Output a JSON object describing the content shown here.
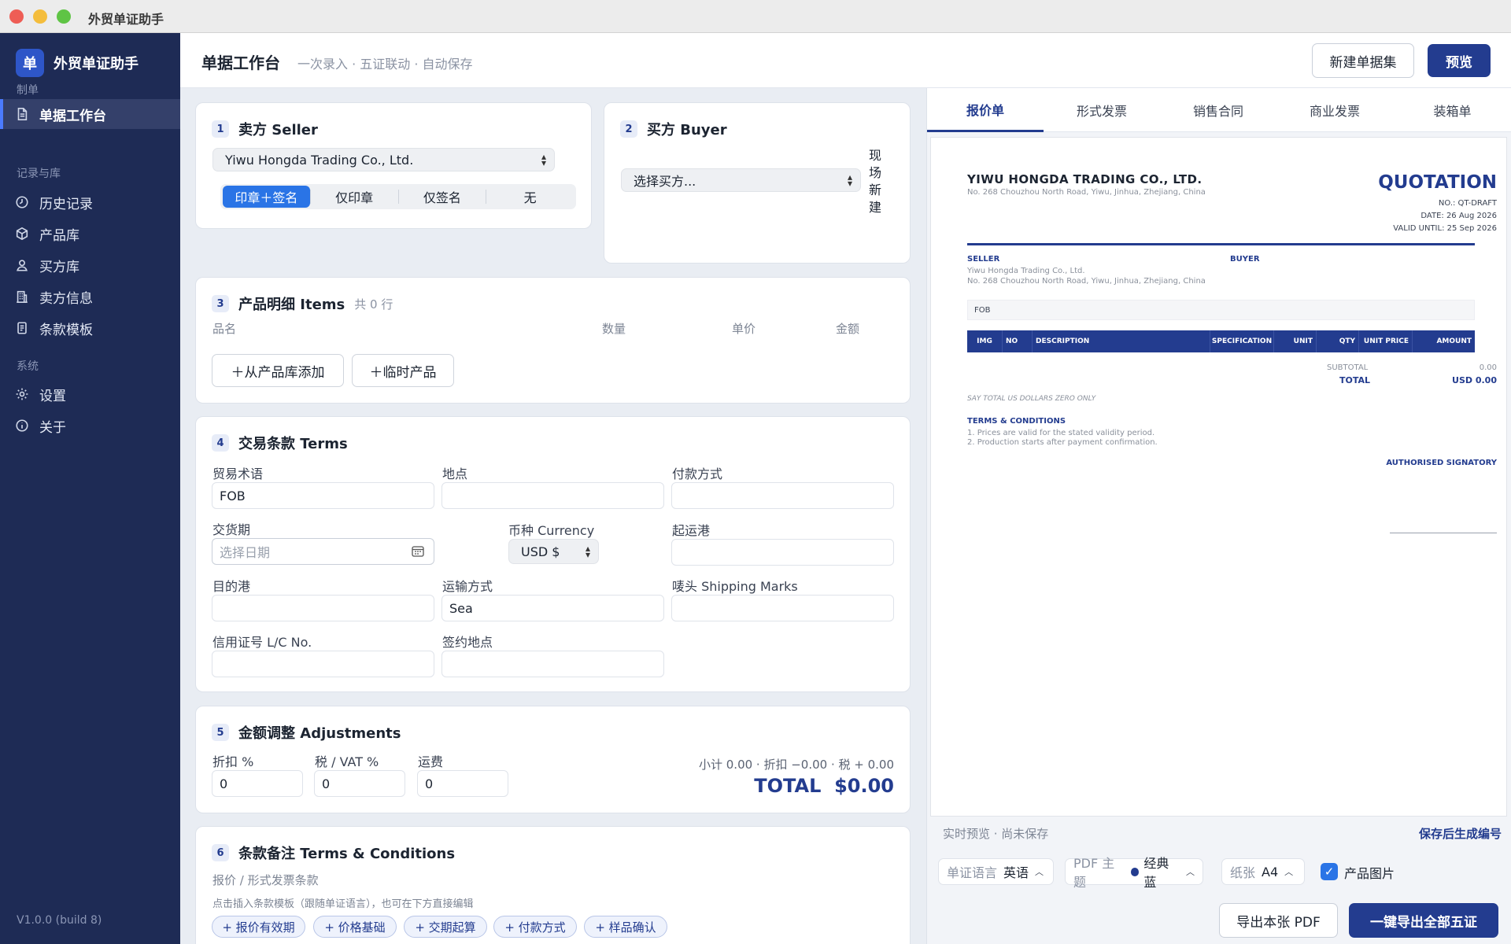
{
  "window": {
    "title": "外贸单证助手"
  },
  "sidebar": {
    "brand_logo": "单",
    "brand_name": "外贸单证助手",
    "sections": [
      {
        "label": "制单"
      },
      {
        "label": "记录与库"
      },
      {
        "label": "系统"
      }
    ],
    "items": [
      {
        "label": "单据工作台",
        "icon": "document-icon",
        "active": true
      },
      {
        "label": "历史记录",
        "icon": "clock-icon"
      },
      {
        "label": "产品库",
        "icon": "box-icon"
      },
      {
        "label": "买方库",
        "icon": "user-icon"
      },
      {
        "label": "卖方信息",
        "icon": "building-icon"
      },
      {
        "label": "条款模板",
        "icon": "template-icon"
      },
      {
        "label": "设置",
        "icon": "gear-icon"
      },
      {
        "label": "关于",
        "icon": "info-icon"
      }
    ],
    "version": "V1.0.0 (build 8)"
  },
  "header": {
    "title": "单据工作台",
    "subtitle": "一次录入 · 五证联动 · 自动保存",
    "new_set_label": "新建单据集",
    "preview_label": "预览"
  },
  "seller": {
    "num": "1",
    "title": "卖方 Seller",
    "selected": "Yiwu Hongda Trading Co., Ltd.",
    "seal_options": [
      "印章＋签名",
      "仅印章",
      "仅签名",
      "无"
    ],
    "seal_active": 0
  },
  "buyer": {
    "num": "2",
    "title": "买方 Buyer",
    "placeholder": "选择买方...",
    "quick_new": [
      "现",
      "场",
      "新",
      "建"
    ]
  },
  "items": {
    "num": "3",
    "title": "产品明细 Items",
    "count_text": "共 0 行",
    "columns": [
      "品名",
      "数量",
      "单价",
      "金额"
    ],
    "add_from_lib": "＋从产品库添加",
    "add_temp": "＋临时产品"
  },
  "terms": {
    "num": "4",
    "title": "交易条款 Terms",
    "trade_term_label": "贸易术语",
    "trade_term_value": "FOB",
    "place_label": "地点",
    "place_value": "",
    "payment_label": "付款方式",
    "payment_value": "",
    "delivery_label": "交货期",
    "delivery_placeholder": "选择日期",
    "currency_label": "币种 Currency",
    "currency_value": "USD $",
    "loading_port_label": "起运港",
    "loading_port_value": "",
    "dest_port_label": "目的港",
    "dest_port_value": "",
    "transport_label": "运输方式",
    "transport_value": "Sea",
    "marks_label": "唛头 Shipping Marks",
    "marks_value": "",
    "lc_label": "信用证号 L/C No.",
    "lc_value": "",
    "sign_place_label": "签约地点",
    "sign_place_value": ""
  },
  "adjust": {
    "num": "5",
    "title": "金额调整 Adjustments",
    "discount_label": "折扣 %",
    "discount_value": "0",
    "tax_label": "税 / VAT %",
    "tax_value": "0",
    "freight_label": "运费",
    "freight_value": "0",
    "summary": "小计 0.00 · 折扣 −0.00 · 税 + 0.00",
    "total": "TOTAL  $0.00"
  },
  "conditions": {
    "num": "6",
    "title": "条款备注 Terms & Conditions",
    "subtitle": "报价 / 形式发票条款",
    "hint": "点击插入条款模板（跟随单证语言），也可在下方直接编辑",
    "chips": [
      "+ 报价有效期",
      "+ 价格基础",
      "+ 交期起算",
      "+ 付款方式",
      "+ 样品确认"
    ]
  },
  "preview": {
    "tabs": [
      "报价单",
      "形式发票",
      "销售合同",
      "商业发票",
      "装箱单"
    ],
    "active_tab": 0,
    "doc": {
      "seller_name": "YIWU HONGDA TRADING CO., LTD.",
      "seller_addr": "No. 268 Chouzhou North Road, Yiwu, Jinhua, Zhejiang, China",
      "doc_title": "QUOTATION",
      "no": "NO.: QT-DRAFT",
      "date": "DATE: 26 Aug 2026",
      "valid": "VALID UNTIL: 25 Sep 2026",
      "seller_label": "SELLER",
      "buyer_label": "BUYER",
      "seller_line1": "Yiwu Hongda Trading Co., Ltd.",
      "seller_line2": "No. 268 Chouzhou North Road, Yiwu, Jinhua, Zhejiang, China",
      "term": "FOB",
      "columns": [
        "IMG",
        "NO",
        "DESCRIPTION",
        "SPECIFICATION",
        "UNIT",
        "QTY",
        "UNIT PRICE",
        "AMOUNT"
      ],
      "subtotal_label": "SUBTOTAL",
      "subtotal_value": "0.00",
      "total_label": "TOTAL",
      "total_value": "USD 0.00",
      "say_total": "SAY TOTAL US DOLLARS ZERO ONLY",
      "tc_label": "TERMS & CONDITIONS",
      "tc_1": "1. Prices are valid for the stated validity period.",
      "tc_2": "2. Production starts after payment confirmation.",
      "signatory": "AUTHORISED SIGNATORY"
    },
    "status": "实时预览 · 尚未保存",
    "save_hint": "保存后生成编号",
    "lang_label": "单证语言",
    "lang_value": "英语",
    "theme_label": "PDF 主题",
    "theme_value": "经典蓝",
    "theme_color": "#233c8f",
    "paper_label": "纸张",
    "paper_value": "A4",
    "images_label": "产品图片",
    "images_checked": true,
    "export_one": "导出本张 PDF",
    "export_all": "一键导出全部五证"
  }
}
